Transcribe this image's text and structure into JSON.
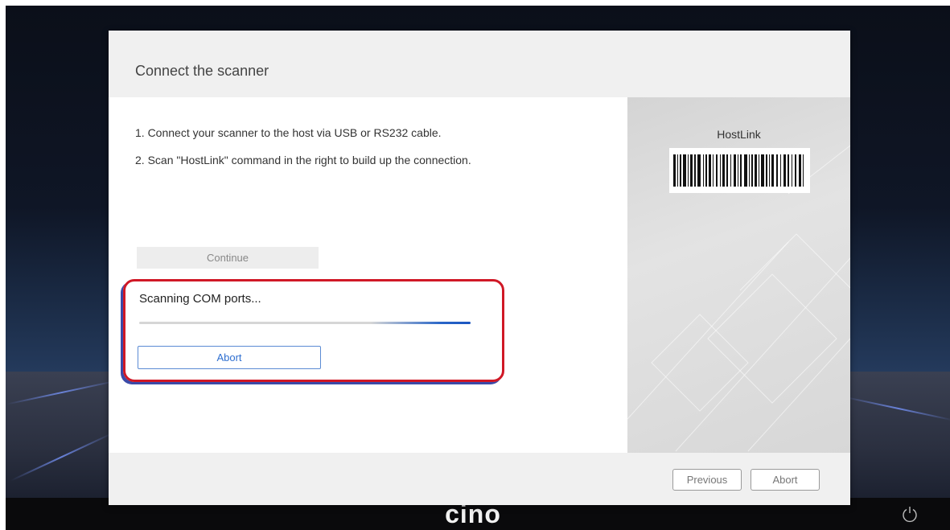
{
  "dialog": {
    "title": "Connect the scanner",
    "steps": [
      "1. Connect your scanner to the host via USB or RS232 cable.",
      "2. Scan \"HostLink\" command in the right to build up the connection."
    ],
    "continue_label": "Continue",
    "scan": {
      "status_text": "Scanning COM ports...",
      "progress": 0.3,
      "abort_label": "Abort"
    },
    "barcode": {
      "title": "HostLink",
      "icon": "barcode-icon"
    },
    "footer": {
      "previous_label": "Previous",
      "abort_label": "Abort"
    }
  },
  "app": {
    "brand": "cino",
    "power_icon": "power-icon"
  },
  "colors": {
    "highlight_border": "#d01826",
    "progress": "#1a55c0",
    "link_blue": "#2f6fd0"
  }
}
